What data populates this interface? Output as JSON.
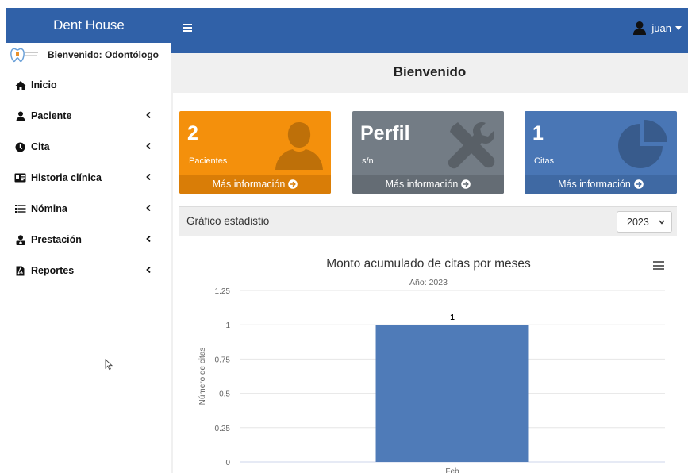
{
  "brand": "Dent House",
  "user": {
    "name": "juan"
  },
  "sidebar": {
    "welcome": "Bienvenido: Odontólogo",
    "items": [
      {
        "label": "Inicio",
        "icon": "home-icon"
      },
      {
        "label": "Paciente",
        "icon": "user-icon"
      },
      {
        "label": "Cita",
        "icon": "clock-icon"
      },
      {
        "label": "Historia clínica",
        "icon": "id-card-icon"
      },
      {
        "label": "Nómina",
        "icon": "list-icon"
      },
      {
        "label": "Prestación",
        "icon": "hospital-user-icon"
      },
      {
        "label": "Reportes",
        "icon": "file-pdf-icon"
      }
    ]
  },
  "main": {
    "title": "Bienvenido",
    "boxes": [
      {
        "number": "2",
        "label": "Pacientes",
        "more": "Más información",
        "color": "#f4900c"
      },
      {
        "number": "Perfil",
        "label": "s/n",
        "more": "Más información",
        "color": "#737c85"
      },
      {
        "number": "1",
        "label": "Citas",
        "more": "Más información",
        "color": "#4976b5"
      }
    ],
    "graph": {
      "header": "Gráfico estadistio",
      "year": "2023"
    }
  },
  "chart_data": {
    "type": "bar",
    "title": "Monto acumulado de citas por meses",
    "subtitle": "Año: 2023",
    "ylabel": "Número de citas",
    "xlabel": "",
    "categories": [
      "Feb"
    ],
    "values": [
      1
    ],
    "data_labels": [
      "1"
    ],
    "ylim": [
      0,
      1.25
    ],
    "yticks": [
      "0",
      "0.25",
      "0.5",
      "0.75",
      "1",
      "1.25"
    ],
    "grid": true,
    "bar_color": "#4f7bb8"
  }
}
